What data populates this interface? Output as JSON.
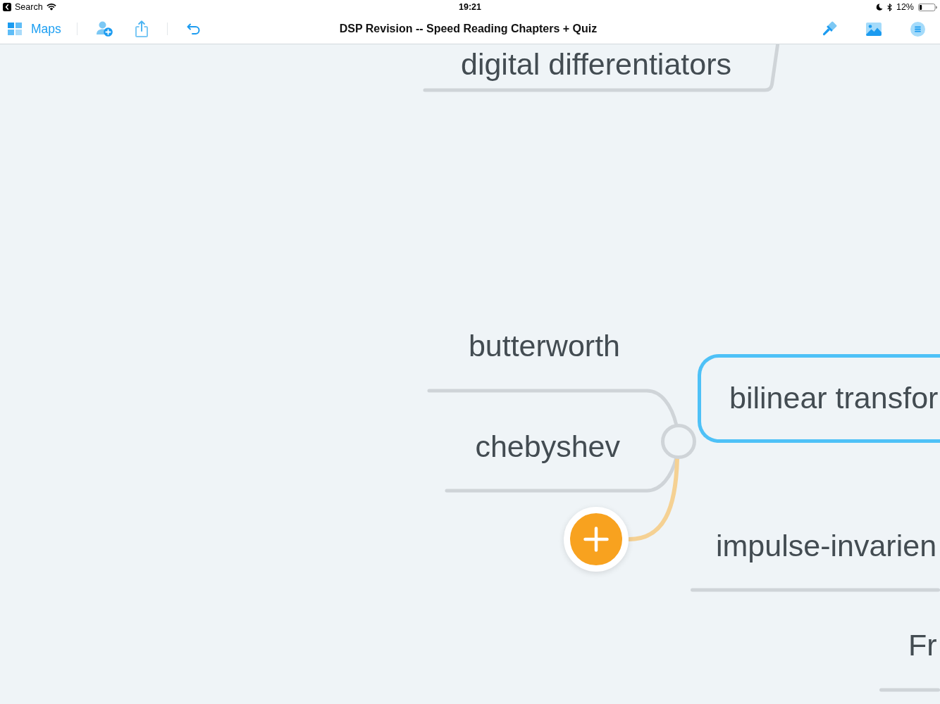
{
  "status_bar": {
    "back_label": "Search",
    "time": "19:21",
    "battery": "12%"
  },
  "toolbar": {
    "maps_label": "Maps",
    "title": "DSP Revision -- Speed Reading Chapters + Quiz"
  },
  "mind_map": {
    "nodes": [
      {
        "text": "digital differentiators",
        "selected": false
      },
      {
        "text": "butterworth",
        "selected": false
      },
      {
        "text": "chebyshev",
        "selected": false
      },
      {
        "text": "bilinear transfor",
        "selected": true
      },
      {
        "text": "impulse-invarien",
        "selected": false
      },
      {
        "text": "Fr",
        "selected": false
      }
    ]
  }
}
